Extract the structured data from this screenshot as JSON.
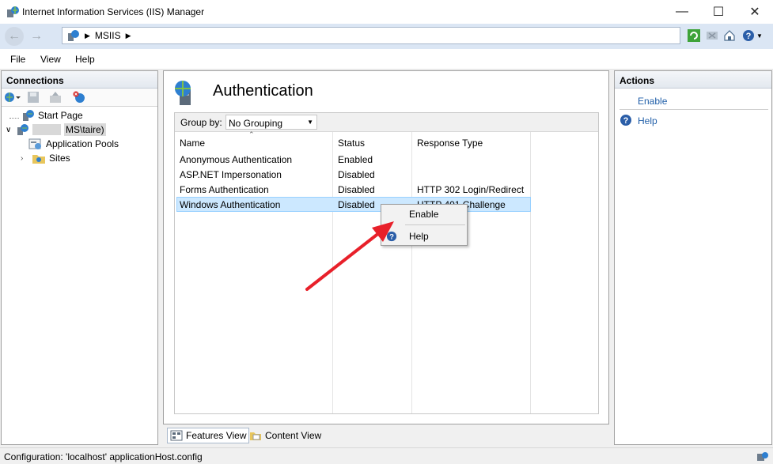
{
  "window": {
    "title": "Internet Information Services (IIS) Manager"
  },
  "address": {
    "segments": [
      "MSIIS"
    ]
  },
  "menu": {
    "items": [
      "File",
      "View",
      "Help"
    ]
  },
  "connections": {
    "title": "Connections",
    "tree": {
      "start_page": "Start Page",
      "server": "MS\\taire)",
      "app_pools": "Application Pools",
      "sites": "Sites"
    }
  },
  "main": {
    "title": "Authentication",
    "group_by_label": "Group by:",
    "group_by_value": "No Grouping",
    "columns": {
      "name": "Name",
      "status": "Status",
      "response": "Response Type"
    },
    "rows": [
      {
        "name": "Anonymous Authentication",
        "status": "Enabled",
        "response": ""
      },
      {
        "name": "ASP.NET Impersonation",
        "status": "Disabled",
        "response": ""
      },
      {
        "name": "Forms Authentication",
        "status": "Disabled",
        "response": "HTTP 302 Login/Redirect"
      },
      {
        "name": "Windows Authentication",
        "status": "Disabled",
        "response": "HTTP 401 Challenge"
      }
    ],
    "tabs": {
      "features": "Features View",
      "content": "Content View"
    }
  },
  "context_menu": {
    "enable": "Enable",
    "help": "Help"
  },
  "actions": {
    "title": "Actions",
    "enable": "Enable",
    "help": "Help"
  },
  "status": {
    "text": "Configuration: 'localhost' applicationHost.config"
  },
  "colors": {
    "accent_link": "#1f5ea8",
    "selection": "#cce8ff",
    "arrow": "#e8202a"
  }
}
